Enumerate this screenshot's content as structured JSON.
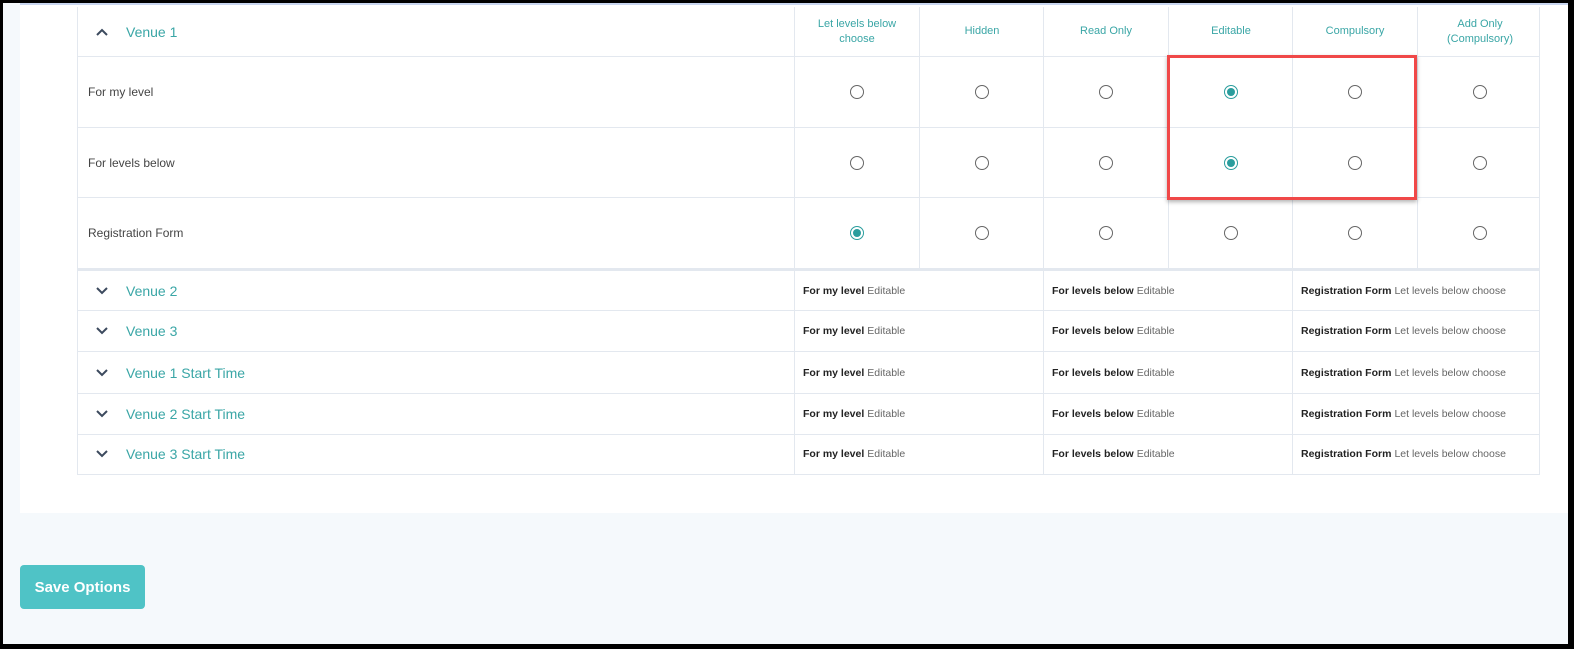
{
  "colors": {
    "accent": "#3aa6a6",
    "radio_selected": "#2a9d9d",
    "button": "#4fc3c6",
    "highlight": "#f04848"
  },
  "expanded": {
    "title": "Venue 1",
    "icon": "chevron-up-icon",
    "columns": [
      "Let levels below choose",
      "Hidden",
      "Read Only",
      "Editable",
      "Compulsory",
      "Add Only (Compulsory)"
    ],
    "rows": [
      {
        "label": "For my level",
        "selected": "Editable"
      },
      {
        "label": "For levels below",
        "selected": "Editable"
      },
      {
        "label": "Registration Form",
        "selected": "Let levels below choose"
      }
    ]
  },
  "collapsed": [
    {
      "title": "Venue 2",
      "items": [
        [
          "For my level",
          "Editable"
        ],
        [
          "For levels below",
          "Editable"
        ],
        [
          "Registration Form",
          "Let levels below choose"
        ]
      ]
    },
    {
      "title": "Venue 3",
      "items": [
        [
          "For my level",
          "Editable"
        ],
        [
          "For levels below",
          "Editable"
        ],
        [
          "Registration Form",
          "Let levels below choose"
        ]
      ]
    },
    {
      "title": "Venue 1 Start Time",
      "items": [
        [
          "For my level",
          "Editable"
        ],
        [
          "For levels below",
          "Editable"
        ],
        [
          "Registration Form",
          "Let levels below choose"
        ]
      ]
    },
    {
      "title": "Venue 2 Start Time",
      "items": [
        [
          "For my level",
          "Editable"
        ],
        [
          "For levels below",
          "Editable"
        ],
        [
          "Registration Form",
          "Let levels below choose"
        ]
      ]
    },
    {
      "title": "Venue 3 Start Time",
      "items": [
        [
          "For my level",
          "Editable"
        ],
        [
          "For levels below",
          "Editable"
        ],
        [
          "Registration Form",
          "Let levels below choose"
        ]
      ]
    }
  ],
  "save_label": "Save Options"
}
